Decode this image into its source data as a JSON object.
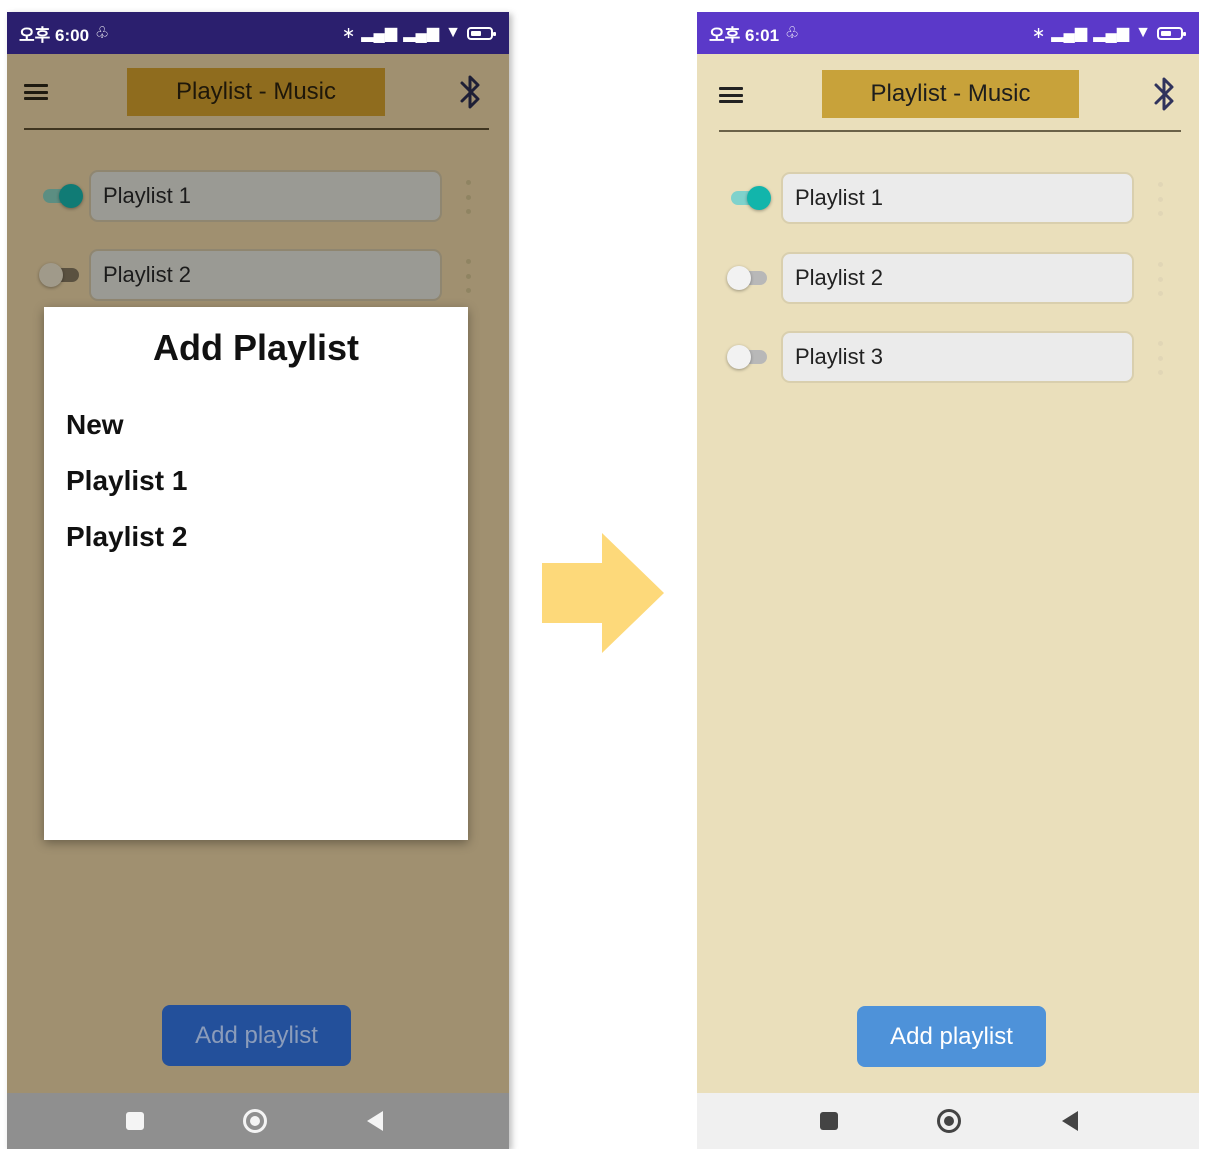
{
  "left_screen": {
    "status_bar": {
      "time": "오후 6:00",
      "icons": [
        "notification-off-icon",
        "bluetooth-icon",
        "signal-icon",
        "signal-icon",
        "wifi-icon",
        "battery-icon"
      ]
    },
    "title": "Playlist - Music",
    "playlists": [
      {
        "name": "Playlist 1",
        "enabled": true
      },
      {
        "name": "Playlist 2",
        "enabled": false
      }
    ],
    "dialog": {
      "title": "Add Playlist",
      "items": [
        "New",
        "Playlist 1",
        "Playlist 2"
      ]
    },
    "add_button": "Add playlist"
  },
  "right_screen": {
    "status_bar": {
      "time": "오후 6:01",
      "icons": [
        "notification-off-icon",
        "bluetooth-icon",
        "signal-icon",
        "signal-icon",
        "wifi-icon",
        "battery-icon"
      ]
    },
    "title": "Playlist - Music",
    "playlists": [
      {
        "name": "Playlist 1",
        "enabled": true
      },
      {
        "name": "Playlist 2",
        "enabled": false
      },
      {
        "name": "Playlist 3",
        "enabled": false
      }
    ],
    "add_button": "Add playlist"
  },
  "colors": {
    "accent_title": "#c8a23a",
    "background": "#eadfbb",
    "button": "#4e92d9",
    "toggle_on": "#12b5ab",
    "status_bar": "#5b39c9",
    "arrow": "#fdd97a"
  }
}
